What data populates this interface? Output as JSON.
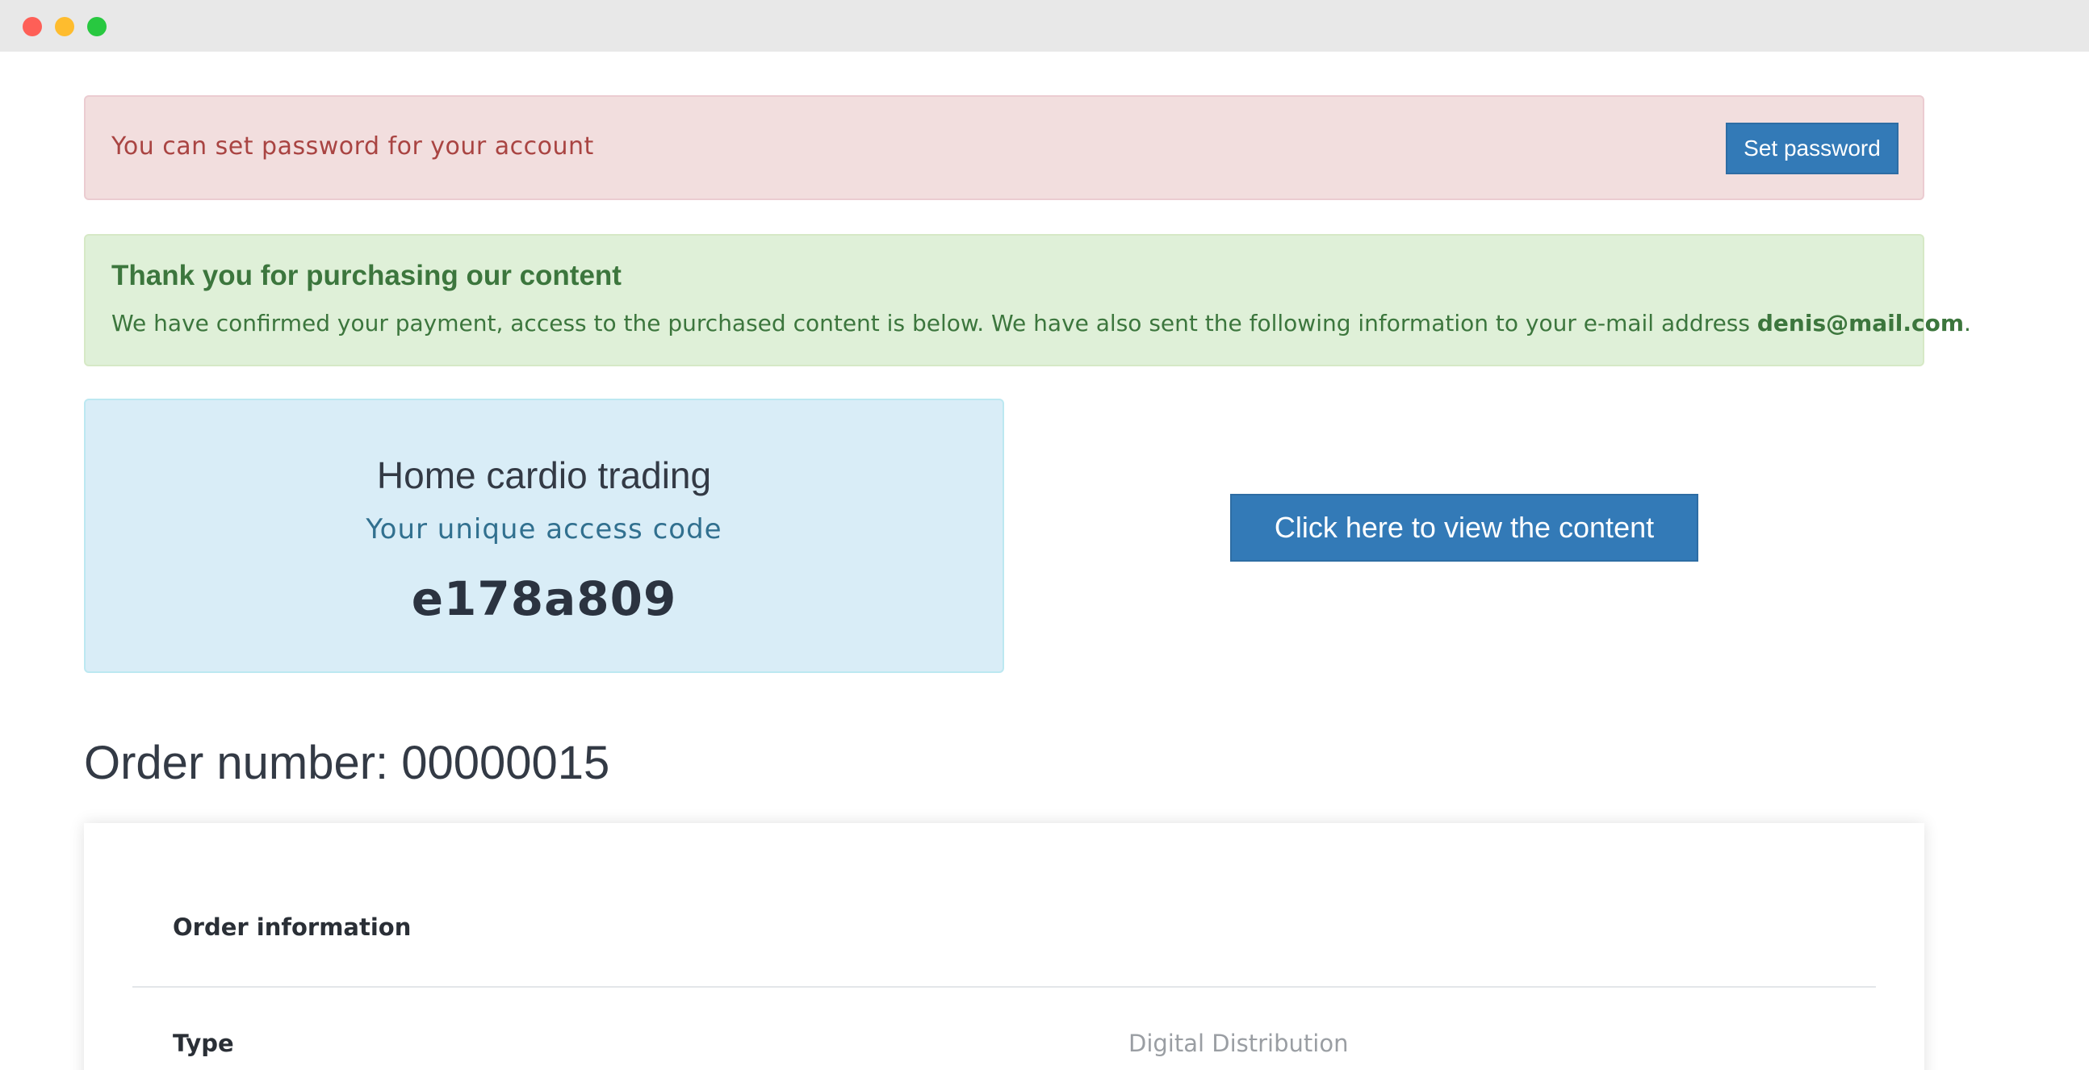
{
  "window": {
    "controls": [
      "close-icon",
      "minimize-icon",
      "maximize-icon"
    ]
  },
  "password_alert": {
    "message": "You can set password for your account",
    "button_label": "Set password"
  },
  "success_alert": {
    "heading": "Thank you for purchasing our content",
    "body_prefix": "We have confirmed your payment, access to the purchased content is below. We have also sent the following information to your e-mail address ",
    "email": "denis@mail.com",
    "body_suffix": "."
  },
  "access": {
    "product_name": "Home cardio trading",
    "subtitle": "Your unique access code",
    "code": "e178a809",
    "view_button_label": "Click here to view the content"
  },
  "order": {
    "title": "Order number: 00000015",
    "section_label": "Order information",
    "rows": [
      {
        "label": "Type",
        "value": "Digital Distribution"
      }
    ]
  },
  "colors": {
    "primary": "#337ab7",
    "danger_bg": "#f2dede",
    "danger_text": "#a94442",
    "success_bg": "#dff0d8",
    "success_text": "#3c763d",
    "info_bg": "#d9edf7",
    "info_text": "#31708f"
  }
}
